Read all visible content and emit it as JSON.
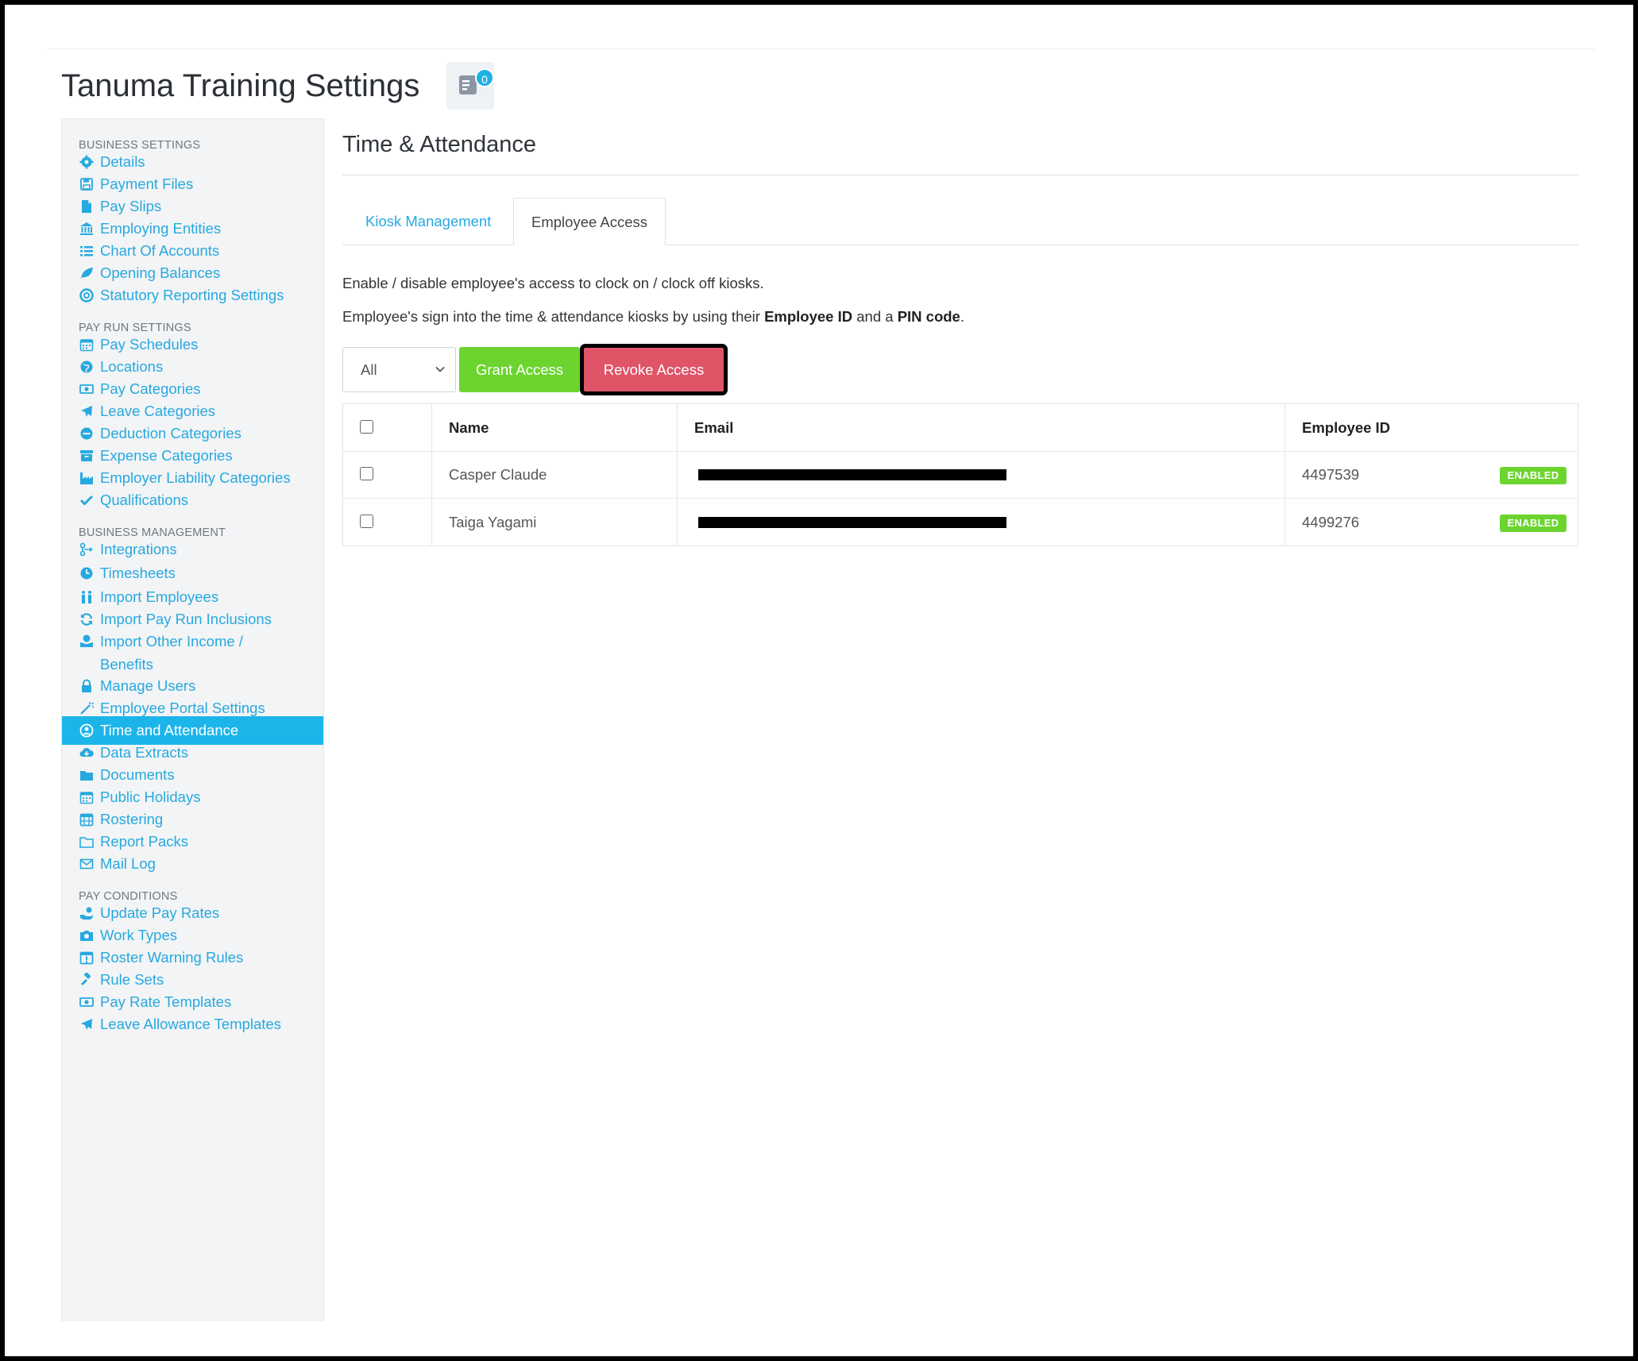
{
  "header": {
    "title": "Tanuma Training Settings",
    "notification_count": "0"
  },
  "sidebar": {
    "sections": [
      {
        "heading": "BUSINESS SETTINGS",
        "items": [
          {
            "label": "Details",
            "icon": "gear-icon"
          },
          {
            "label": "Payment Files",
            "icon": "floppy-icon"
          },
          {
            "label": "Pay Slips",
            "icon": "file-icon"
          },
          {
            "label": "Employing Entities",
            "icon": "bank-icon"
          },
          {
            "label": "Chart Of Accounts",
            "icon": "list-icon"
          },
          {
            "label": "Opening Balances",
            "icon": "leaf-icon"
          },
          {
            "label": "Statutory Reporting Settings",
            "icon": "lifebuoy-icon"
          }
        ]
      },
      {
        "heading": "PAY RUN SETTINGS",
        "items": [
          {
            "label": "Pay Schedules",
            "icon": "calendar-icon"
          },
          {
            "label": "Locations",
            "icon": "globe-icon"
          },
          {
            "label": "Pay Categories",
            "icon": "money-icon"
          },
          {
            "label": "Leave Categories",
            "icon": "plane-icon"
          },
          {
            "label": "Deduction Categories",
            "icon": "minus-circle-icon"
          },
          {
            "label": "Expense Categories",
            "icon": "archive-icon"
          },
          {
            "label": "Employer Liability Categories",
            "icon": "industry-icon"
          },
          {
            "label": "Qualifications",
            "icon": "check-icon"
          }
        ]
      },
      {
        "heading": "BUSINESS MANAGEMENT",
        "items": [
          {
            "label": "Integrations",
            "icon": "integration-icon"
          },
          {
            "label": "Timesheets",
            "icon": "clock-icon"
          },
          {
            "label": "Import Employees",
            "icon": "people-icon"
          },
          {
            "label": "Import Pay Run Inclusions",
            "icon": "refresh-icon"
          },
          {
            "label": "Import Other Income / Benefits",
            "icon": "benefits-icon"
          },
          {
            "label": "Manage Users",
            "icon": "lock-icon"
          },
          {
            "label": "Employee Portal Settings",
            "icon": "wand-icon"
          },
          {
            "label": "Time and Attendance",
            "icon": "user-circle-icon"
          },
          {
            "label": "Data Extracts",
            "icon": "cloud-download-icon"
          },
          {
            "label": "Documents",
            "icon": "folder-icon"
          },
          {
            "label": "Public Holidays",
            "icon": "calendar-icon"
          },
          {
            "label": "Rostering",
            "icon": "calendar-grid-icon"
          },
          {
            "label": "Report Packs",
            "icon": "folder-open-icon"
          },
          {
            "label": "Mail Log",
            "icon": "envelope-icon"
          }
        ]
      },
      {
        "heading": "PAY CONDITIONS",
        "items": [
          {
            "label": "Update Pay Rates",
            "icon": "hand-money-icon"
          },
          {
            "label": "Work Types",
            "icon": "camera-icon"
          },
          {
            "label": "Roster Warning Rules",
            "icon": "calendar-alert-icon"
          },
          {
            "label": "Rule Sets",
            "icon": "gavel-icon"
          },
          {
            "label": "Pay Rate Templates",
            "icon": "money-icon"
          },
          {
            "label": "Leave Allowance Templates",
            "icon": "plane-icon"
          }
        ]
      }
    ],
    "active_item": "Time and Attendance"
  },
  "main": {
    "title": "Time & Attendance",
    "tabs": [
      {
        "label": "Kiosk Management",
        "active": false
      },
      {
        "label": "Employee Access",
        "active": true
      }
    ],
    "description_1": "Enable / disable employee's access to clock on / clock off kiosks.",
    "description_2": {
      "prefix": "Employee's sign into the time & attendance kiosks by using their ",
      "bold1": "Employee ID",
      "middle": " and a ",
      "bold2": "PIN code",
      "suffix": "."
    },
    "filter": {
      "selected": "All"
    },
    "buttons": {
      "grant": "Grant Access",
      "revoke": "Revoke Access"
    },
    "table": {
      "columns": [
        "Name",
        "Email",
        "Employee ID"
      ],
      "rows": [
        {
          "name": "Casper Claude",
          "email": "[redacted]",
          "employee_id": "4497539",
          "status": "ENABLED"
        },
        {
          "name": "Taiga Yagami",
          "email": "[redacted]",
          "employee_id": "4499276",
          "status": "ENABLED"
        }
      ]
    }
  },
  "colors": {
    "accent": "#26a9e0",
    "active_bg": "#1cb5ea",
    "grant": "#6cd42f",
    "revoke": "#e05468",
    "status_enabled": "#6cd42f"
  }
}
